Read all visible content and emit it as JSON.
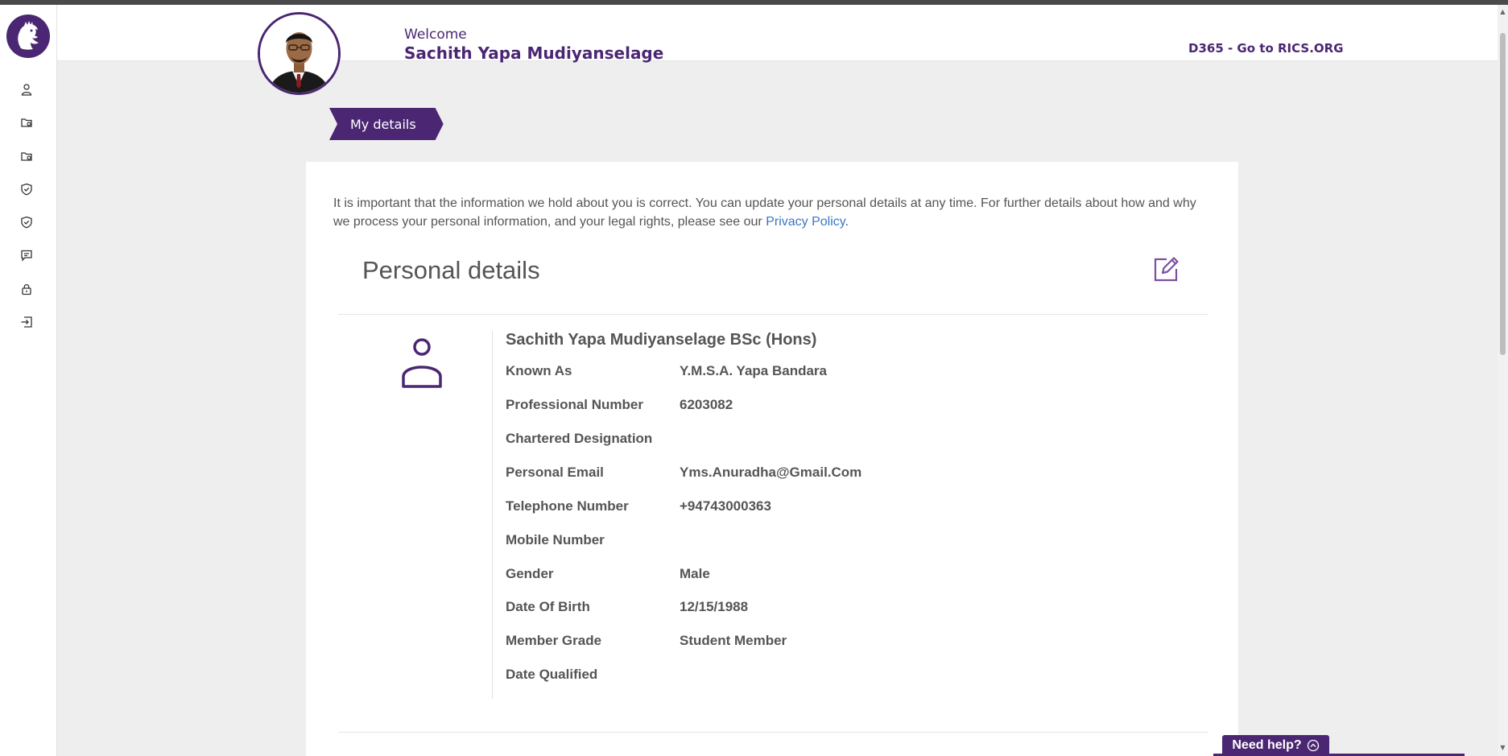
{
  "header": {
    "welcome": "Welcome",
    "user_name": "Sachith Yapa Mudiyanselage",
    "rics_link": "D365 - Go to RICS.ORG"
  },
  "sidebar": {
    "items": [
      {
        "icon": "user-icon"
      },
      {
        "icon": "folder-icon"
      },
      {
        "icon": "folder-icon"
      },
      {
        "icon": "shield-check-icon"
      },
      {
        "icon": "shield-check-icon"
      },
      {
        "icon": "message-icon"
      },
      {
        "icon": "lock-icon"
      },
      {
        "icon": "logout-icon"
      }
    ]
  },
  "tab": {
    "label": "My details"
  },
  "intro": {
    "text": "It is important that the information we hold about you is correct. You can update your personal details at any time. For further details about how and why we process your personal information, and your legal rights, please see our ",
    "link": "Privacy Policy",
    "suffix": "."
  },
  "personal": {
    "title": "Personal details",
    "full_name": "Sachith Yapa Mudiyanselage BSc (Hons)",
    "fields": [
      {
        "label": "Known As",
        "value": "Y.M.S.A. Yapa Bandara"
      },
      {
        "label": "Professional Number",
        "value": "6203082"
      },
      {
        "label": "Chartered Designation",
        "value": ""
      },
      {
        "label": "Personal Email",
        "value": "Yms.Anuradha@Gmail.Com"
      },
      {
        "label": "Telephone Number",
        "value": "+94743000363"
      },
      {
        "label": "Mobile Number",
        "value": ""
      },
      {
        "label": "Gender",
        "value": "Male"
      },
      {
        "label": "Date Of Birth",
        "value": "12/15/1988"
      },
      {
        "label": "Member Grade",
        "value": "Student Member"
      },
      {
        "label": "Date Qualified",
        "value": ""
      }
    ]
  },
  "help": {
    "label": "Need help?"
  },
  "colors": {
    "brand": "#4b2773",
    "link": "#3a76c4",
    "background": "#eeeeee"
  }
}
